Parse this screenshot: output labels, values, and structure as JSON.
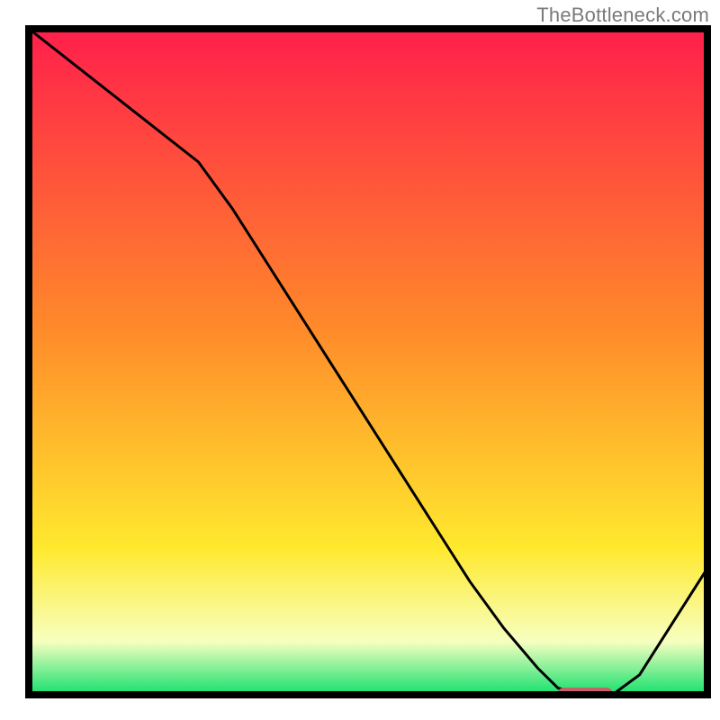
{
  "attribution": "TheBottleneck.com",
  "colors": {
    "gradient_top": "#ff1f4b",
    "gradient_mid1": "#ff8a2a",
    "gradient_mid2": "#ffe92e",
    "gradient_low": "#f7ffc0",
    "gradient_bottom": "#14e06e",
    "curve": "#000000",
    "axis": "#000000",
    "marker": "#c26367"
  },
  "chart_data": {
    "type": "line",
    "title": "",
    "xlabel": "",
    "ylabel": "",
    "xlim": [
      0,
      100
    ],
    "ylim": [
      0,
      100
    ],
    "grid": false,
    "legend_position": "none",
    "series": [
      {
        "name": "bottleneck-curve",
        "x": [
          0,
          5,
          10,
          15,
          20,
          25,
          30,
          35,
          40,
          45,
          50,
          55,
          60,
          65,
          70,
          75,
          78,
          82,
          86,
          90,
          95,
          100
        ],
        "values": [
          100,
          96,
          92,
          88,
          84,
          80,
          73,
          65,
          57,
          49,
          41,
          33,
          25,
          17,
          10,
          4,
          1,
          0,
          0,
          3,
          11,
          19
        ]
      }
    ],
    "annotations": [
      {
        "name": "optimal-marker",
        "type": "bar",
        "x_start": 78,
        "x_end": 86,
        "y": 0
      }
    ]
  }
}
